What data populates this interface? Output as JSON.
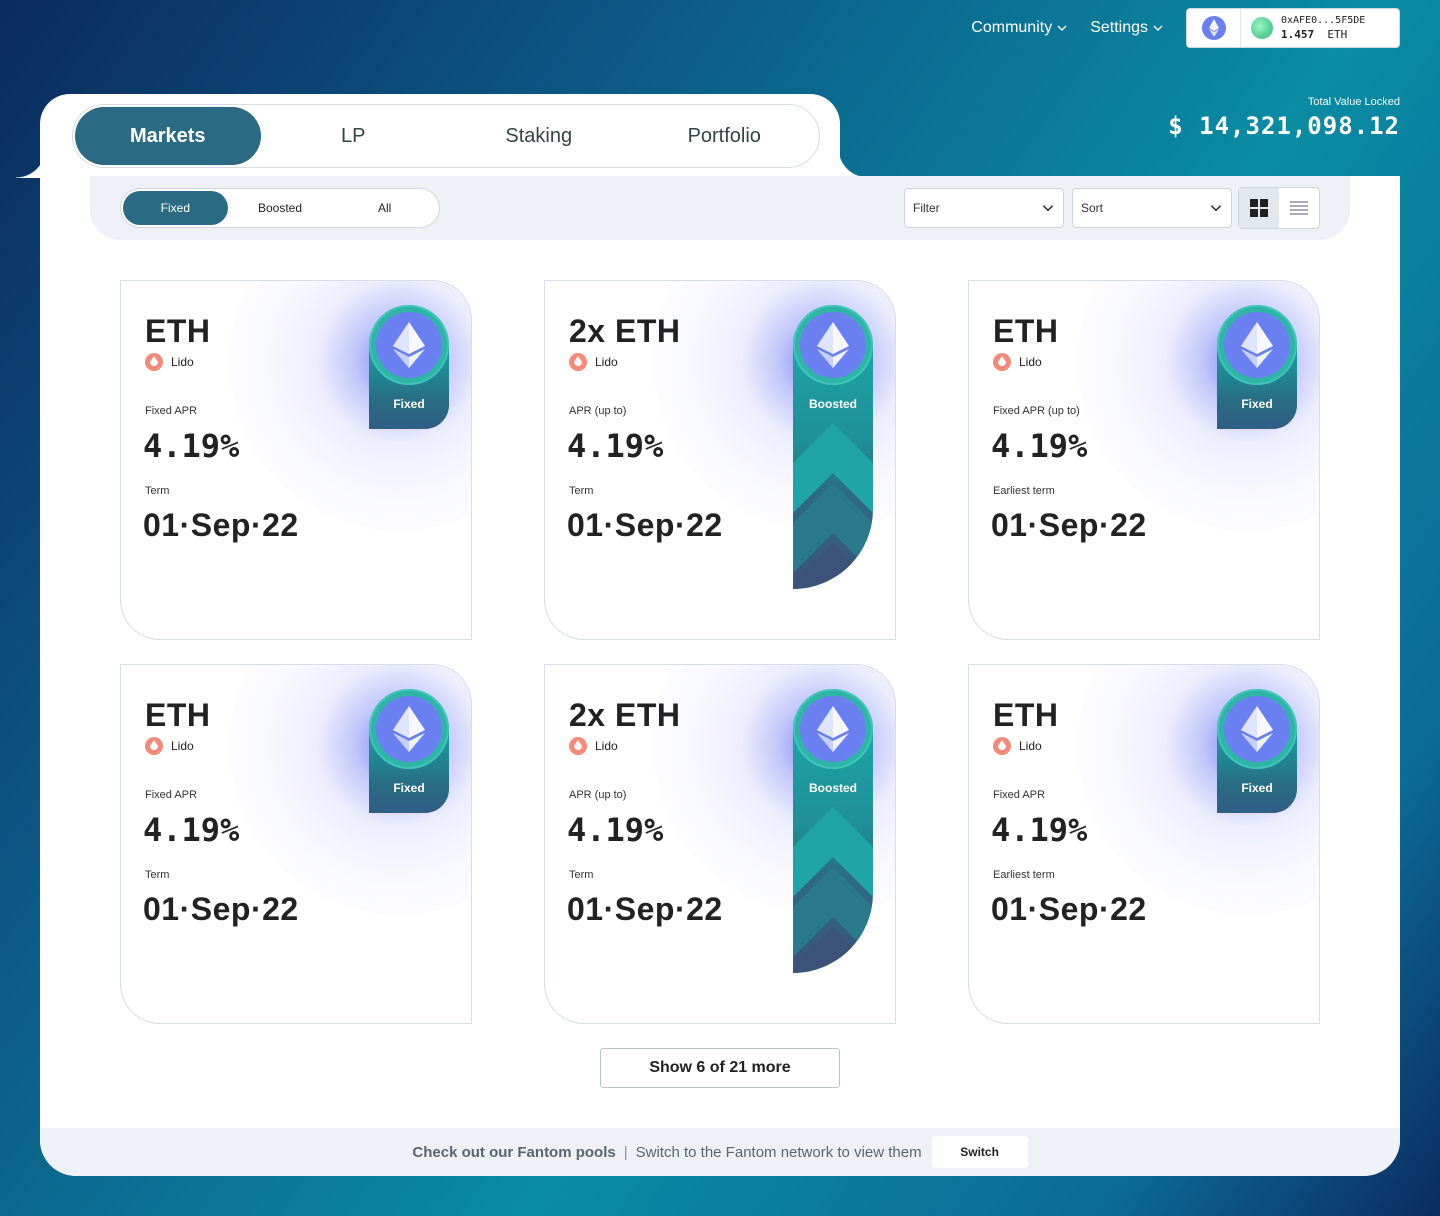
{
  "header": {
    "community_label": "Community",
    "settings_label": "Settings",
    "wallet": {
      "address": "0xAFE0...5F5DE",
      "balance": "1.457",
      "currency": "ETH"
    }
  },
  "tvl": {
    "label": "Total Value Locked",
    "value": "$ 14,321,098.12"
  },
  "tabs": [
    {
      "label": "Markets",
      "active": true
    },
    {
      "label": "LP",
      "active": false
    },
    {
      "label": "Staking",
      "active": false
    },
    {
      "label": "Portfolio",
      "active": false
    }
  ],
  "segments": [
    {
      "label": "Fixed",
      "active": true
    },
    {
      "label": "Boosted",
      "active": false
    },
    {
      "label": "All",
      "active": false
    }
  ],
  "filter": {
    "label": "Filter"
  },
  "sort": {
    "label": "Sort"
  },
  "view_mode": "grid",
  "cards": [
    {
      "symbol": "ETH",
      "provider": "Lido",
      "apr_label": "Fixed APR",
      "apr": "4.19%",
      "term_label": "Term",
      "term": "01·Sep·22",
      "badge": "Fixed"
    },
    {
      "symbol": "2x ETH",
      "provider": "Lido",
      "apr_label": "APR (up to)",
      "apr": "4.19%",
      "term_label": "Term",
      "term": "01·Sep·22",
      "badge": "Boosted"
    },
    {
      "symbol": "ETH",
      "provider": "Lido",
      "apr_label": "Fixed APR (up to)",
      "apr": "4.19%",
      "term_label": "Earliest term",
      "term": "01·Sep·22",
      "badge": "Fixed"
    },
    {
      "symbol": "ETH",
      "provider": "Lido",
      "apr_label": "Fixed APR",
      "apr": "4.19%",
      "term_label": "Term",
      "term": "01·Sep·22",
      "badge": "Fixed"
    },
    {
      "symbol": "2x ETH",
      "provider": "Lido",
      "apr_label": "APR (up to)",
      "apr": "4.19%",
      "term_label": "Term",
      "term": "01·Sep·22",
      "badge": "Boosted"
    },
    {
      "symbol": "ETH",
      "provider": "Lido",
      "apr_label": "Fixed APR",
      "apr": "4.19%",
      "term_label": "Earliest term",
      "term": "01·Sep·22",
      "badge": "Fixed"
    }
  ],
  "show_more_label": "Show 6 of 21 more",
  "footer": {
    "bold_text": "Check out our Fantom pools",
    "separator": "|",
    "text": "Switch to the Fantom network to view them",
    "button_label": "Switch"
  },
  "colors": {
    "accent": "#2a6a82",
    "teal": "#17a3a3",
    "eth": "#6a7ff0",
    "lido": "#f48b76"
  }
}
